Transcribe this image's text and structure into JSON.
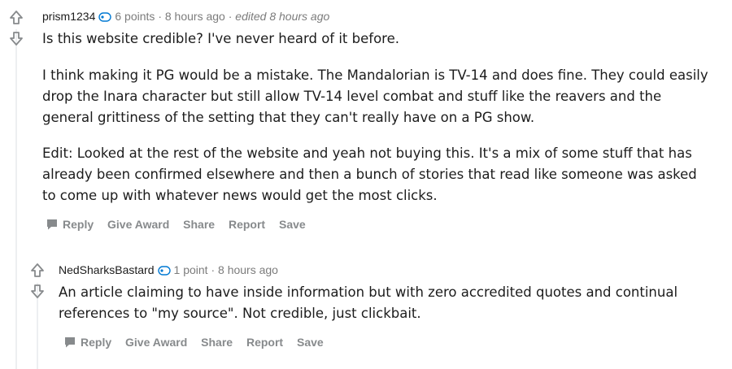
{
  "comments": [
    {
      "author": "prism1234",
      "points": "6 points",
      "separator": "·",
      "time": "8 hours ago",
      "edited": "edited 8 hours ago",
      "body": [
        "Is this website credible? I've never heard of it before.",
        "I think making it PG would be a mistake. The Mandalorian is TV-14 and does fine. They could easily drop the Inara character but still allow TV-14 level combat and stuff like the reavers and the general grittiness of the setting that they can't really have on a PG show.",
        "Edit: Looked at the rest of the website and yeah not buying this. It's a mix of some stuff that has already been confirmed elsewhere and then a bunch of stories that read like someone was asked to come up with whatever news would get the most clicks."
      ],
      "actions": {
        "reply": "Reply",
        "award": "Give Award",
        "share": "Share",
        "report": "Report",
        "save": "Save"
      }
    },
    {
      "author": "NedSharksBastard",
      "points": "1 point",
      "separator": "·",
      "time": "8 hours ago",
      "body": [
        "An article claiming to have inside information but with zero accredited quotes and continual references to \"my source\". Not credible, just clickbait."
      ],
      "actions": {
        "reply": "Reply",
        "award": "Give Award",
        "share": "Share",
        "report": "Report",
        "save": "Save"
      }
    }
  ],
  "icons": {
    "upvote": "upvote-arrow-icon",
    "downvote": "downvote-arrow-icon",
    "flair": "flair-badge-icon",
    "reply": "speech-bubble-icon"
  },
  "colors": {
    "text": "#1c1c1c",
    "meta": "#7c7c7c",
    "action": "#878a8c",
    "flair": "#0079d3",
    "thread_line": "#edeff1"
  }
}
